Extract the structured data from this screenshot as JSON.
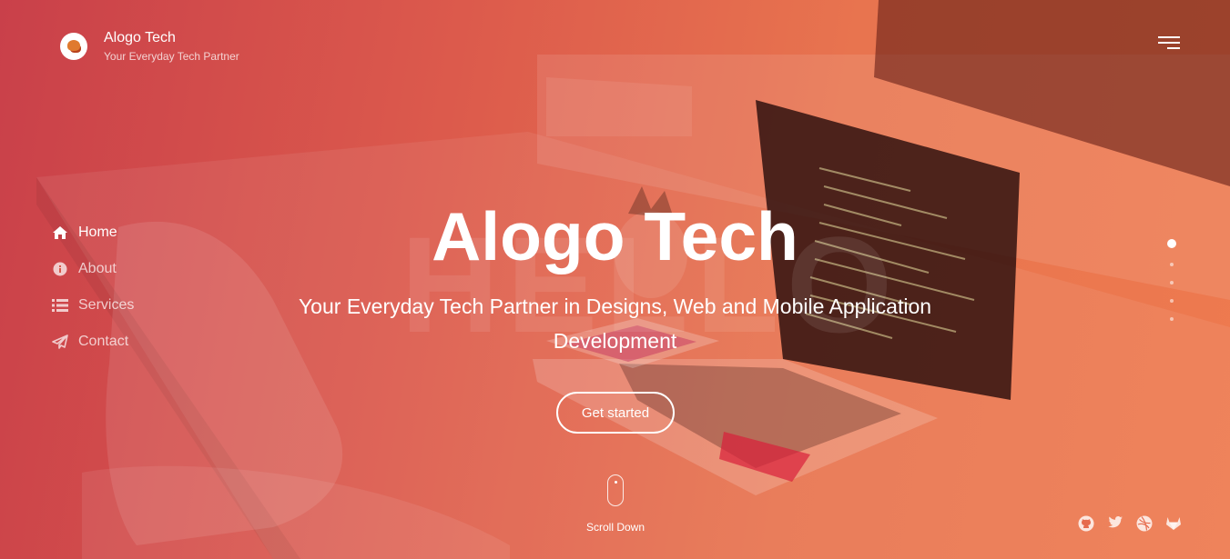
{
  "brand": {
    "title": "Alogo Tech",
    "subtitle": "Your Everyday Tech Partner",
    "logo_icon": "brand-logo-icon"
  },
  "nav": {
    "items": [
      {
        "label": "Home",
        "icon": "home-icon",
        "active": true
      },
      {
        "label": "About",
        "icon": "info-icon",
        "active": false
      },
      {
        "label": "Services",
        "icon": "list-icon",
        "active": false
      },
      {
        "label": "Contact",
        "icon": "paper-plane-icon",
        "active": false
      }
    ]
  },
  "hero": {
    "background_word": "HELLO",
    "title": "Alogo Tech",
    "subtitle": "Your Everyday Tech Partner in Designs, Web and Mobile Application Development",
    "cta_label": "Get started",
    "scroll_label": "Scroll Down"
  },
  "pagination": {
    "count": 5,
    "active_index": 0
  },
  "socials": [
    "github-icon",
    "twitter-icon",
    "dribbble-icon",
    "gitlab-icon"
  ],
  "colors": {
    "overlay_start": "#c9404a",
    "overlay_end": "#ee7a4f",
    "text": "#ffffff"
  }
}
